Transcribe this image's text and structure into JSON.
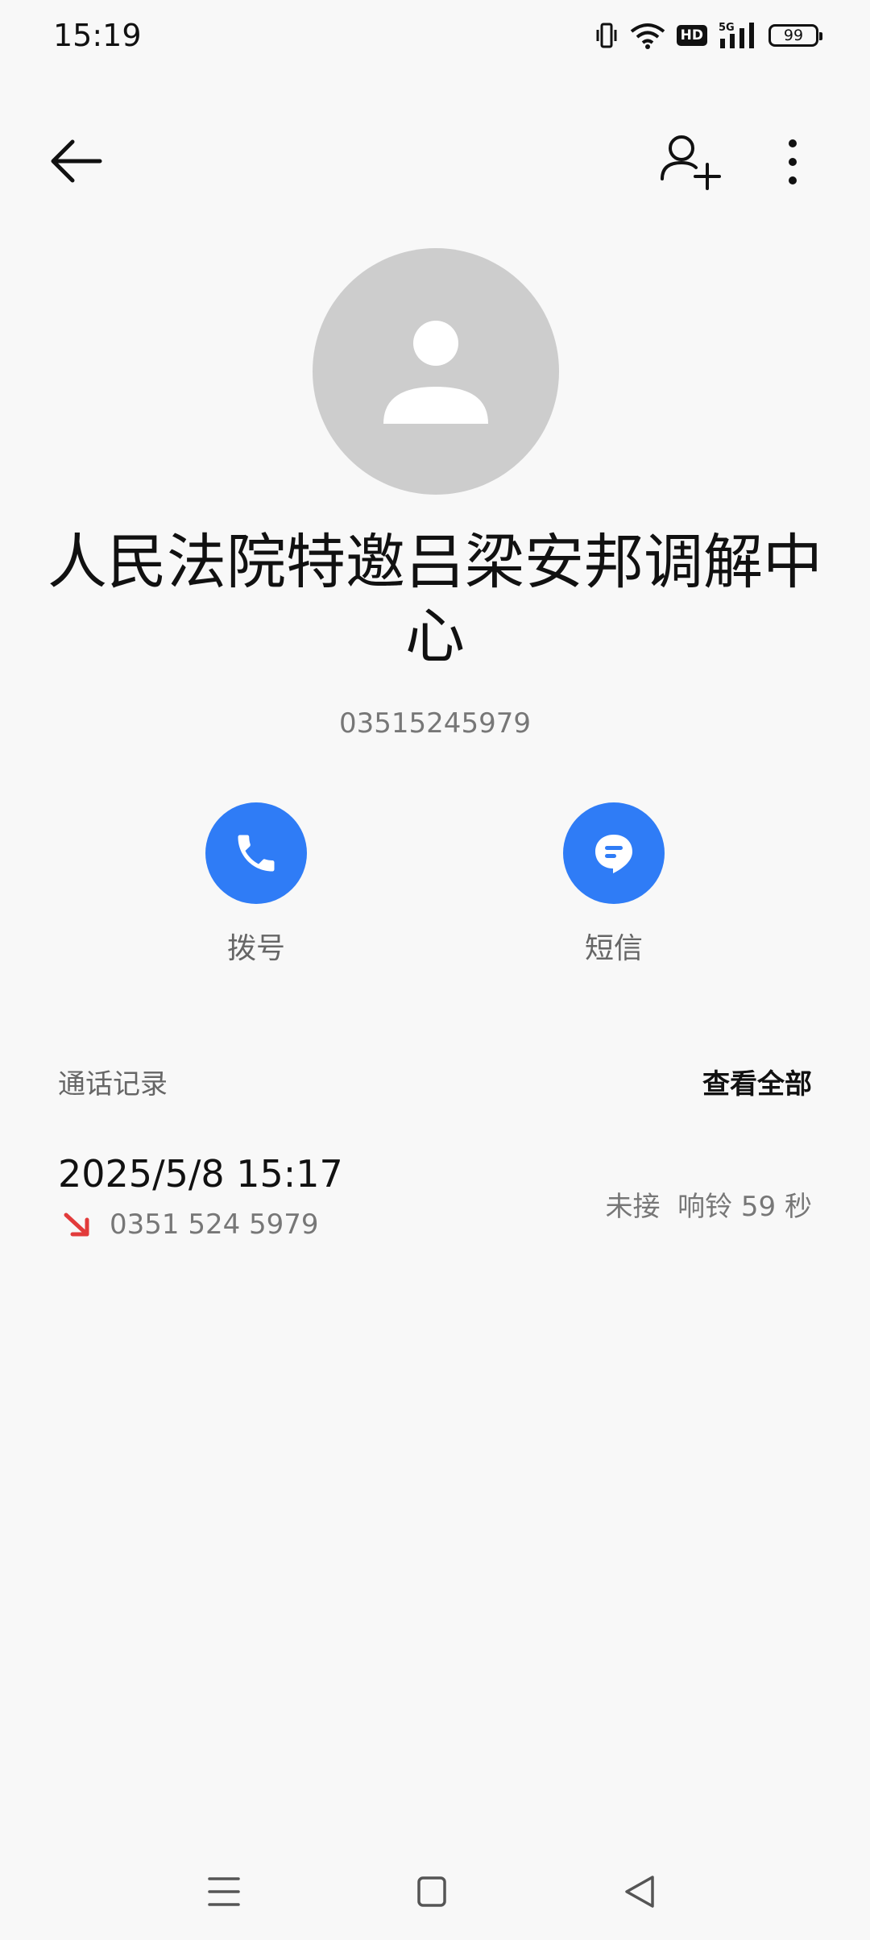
{
  "status_bar": {
    "time": "15:19",
    "network": "5G",
    "hd": "HD",
    "battery": "99",
    "icons": [
      "vibrate-icon",
      "wifi-icon",
      "hd-icon",
      "signal-5g-icon",
      "battery-icon"
    ]
  },
  "toolbar": {
    "back_icon": "back-arrow-icon",
    "add_icon": "add-contact-icon",
    "more_icon": "more-vert-icon"
  },
  "contact": {
    "name": "人民法院特邀吕梁安邦调解中心",
    "number": "03515245979"
  },
  "actions": {
    "dial_label": "拨号",
    "sms_label": "短信"
  },
  "call_log": {
    "title": "通话记录",
    "view_all": "查看全部",
    "entries": [
      {
        "datetime": "2025/5/8 15:17",
        "number": "0351 524 5979",
        "status": "未接  响铃 59 秒",
        "type": "missed"
      }
    ]
  },
  "colors": {
    "accent": "#2f7cf6",
    "missed": "#e23b3b",
    "avatar_bg": "#cdcdcd",
    "background": "#f8f8f8"
  }
}
